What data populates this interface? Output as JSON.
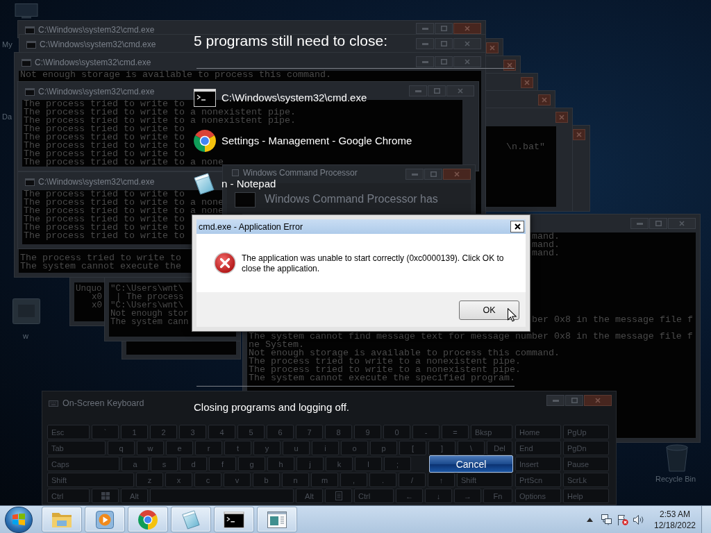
{
  "desktop_icons": [
    {
      "kind": "computer",
      "label": "My"
    },
    {
      "kind": "label_only",
      "label": "Da"
    },
    {
      "kind": "shortcut",
      "label": "w"
    },
    {
      "kind": "recycle_bin",
      "label": "Recycle Bin"
    }
  ],
  "background_windows": [
    {
      "kind": "console"
    },
    {
      "kind": "console",
      "lines": [
        "\\n.bat\""
      ]
    },
    {
      "kind": "console"
    },
    {
      "kind": "console"
    },
    {
      "kind": "console"
    },
    {
      "kind": "console"
    },
    {
      "kind": "console",
      "title": "C:\\Windows\\system32\\cmd.exe"
    },
    {
      "kind": "console",
      "title": "C:\\Windows\\system32\\cmd.exe"
    },
    {
      "kind": "console",
      "lines": [
        "Unquo",
        "x0",
        "x0"
      ]
    },
    {
      "kind": "console"
    },
    {
      "kind": "console",
      "lines": [
        "\"C:\\Users\\wnt\\",
        "| The process",
        "\"C:\\Users\\wnt\\",
        "Not enough stor",
        "The system cann"
      ]
    },
    {
      "kind": "console",
      "title": "C:\\Windows\\system32\\cmd.exe",
      "lines": [
        "Not enough storage is available to process this command.",
        "The process tried to write to",
        "The system cannot execute the"
      ]
    },
    {
      "kind": "console",
      "title": "C:\\Windows\\system32\\cmd.exe",
      "lines": [
        "The process tried to write to",
        "The process tried to write to a nonexistent pipe.",
        "The process tried to write to a nonexistent pipe.",
        "The process tried to write to",
        "The process tried to write to",
        "The process tried to write to",
        "The process tried to write to",
        "The process tried to write to a none"
      ]
    },
    {
      "kind": "console",
      "title": "C:\\Windows\\system32\\cmd.exe",
      "lines": [
        "The process tried to write to",
        "The process tried to write to a none",
        "The process tried to write to a none",
        "The process tried to write to",
        "The process tried to write to",
        "The process tried to write to"
      ]
    },
    {
      "kind": "error_report",
      "title": "Windows Command Processor",
      "message": "Windows Command Processor has"
    },
    {
      "kind": "console",
      "lines": [
        "mand.",
        "mand.",
        "mand.",
        "ber 0x8 in the message file f",
        "The system cannot find message text for message number 0x8 in the message file f",
        "ne System.",
        "Not enough storage is available to process this command.",
        "The process tried to write to a nonexistent pipe.",
        "The process tried to write to a nonexistent pipe.",
        "The system cannot execute the specified program."
      ]
    }
  ],
  "on_screen_keyboard": {
    "title": "On-Screen Keyboard",
    "main_rows": [
      [
        "Esc",
        "`",
        "1",
        "2",
        "3",
        "4",
        "5",
        "6",
        "7",
        "8",
        "9",
        "0",
        "-",
        "=",
        "Bksp"
      ],
      [
        "Tab",
        "q",
        "w",
        "e",
        "r",
        "t",
        "y",
        "u",
        "i",
        "o",
        "p",
        "[",
        "]",
        "\\",
        "Del"
      ],
      [
        "Caps",
        "a",
        "s",
        "d",
        "f",
        "g",
        "h",
        "j",
        "k",
        "l",
        ";"
      ],
      [
        "Shift",
        "z",
        "x",
        "c",
        "v",
        "b",
        "n",
        "m",
        ",",
        ".",
        "/",
        "↑",
        "Shift"
      ],
      [
        "Ctrl",
        {
          "kind": "windows_logo"
        },
        "Alt",
        {
          "kind": "space"
        },
        "Alt",
        {
          "kind": "menu"
        },
        "Ctrl",
        "←",
        "↓",
        "→",
        "Fn"
      ]
    ],
    "nav_rows": [
      [
        "Home",
        "PgUp"
      ],
      [
        "End",
        "PgDn"
      ],
      [
        "Insert",
        "Pause"
      ],
      [
        "PrtScn",
        "ScrLk"
      ],
      [
        "Options",
        "Help"
      ]
    ]
  },
  "logoff": {
    "heading": "5 programs still need to close:",
    "programs": [
      {
        "kind": "console",
        "name": "C:\\Windows\\system32\\cmd.exe"
      },
      {
        "kind": "chrome",
        "name": "Settings - Management - Google Chrome"
      },
      {
        "kind": "notepad",
        "name": "n - Notepad"
      }
    ],
    "status": "Closing programs and logging off.",
    "cancel": "Cancel"
  },
  "error_dialog": {
    "title": "cmd.exe - Application Error",
    "message": "The application was unable to start correctly (0xc0000139). Click OK to close the application.",
    "button": "OK"
  },
  "taskbar": {
    "apps": [
      {
        "kind": "explorer"
      },
      {
        "kind": "media_player"
      },
      {
        "kind": "chrome"
      },
      {
        "kind": "notepad"
      },
      {
        "kind": "console"
      },
      {
        "kind": "app_window"
      }
    ],
    "clock": {
      "time": "2:53 AM",
      "date": "12/18/2022"
    }
  }
}
